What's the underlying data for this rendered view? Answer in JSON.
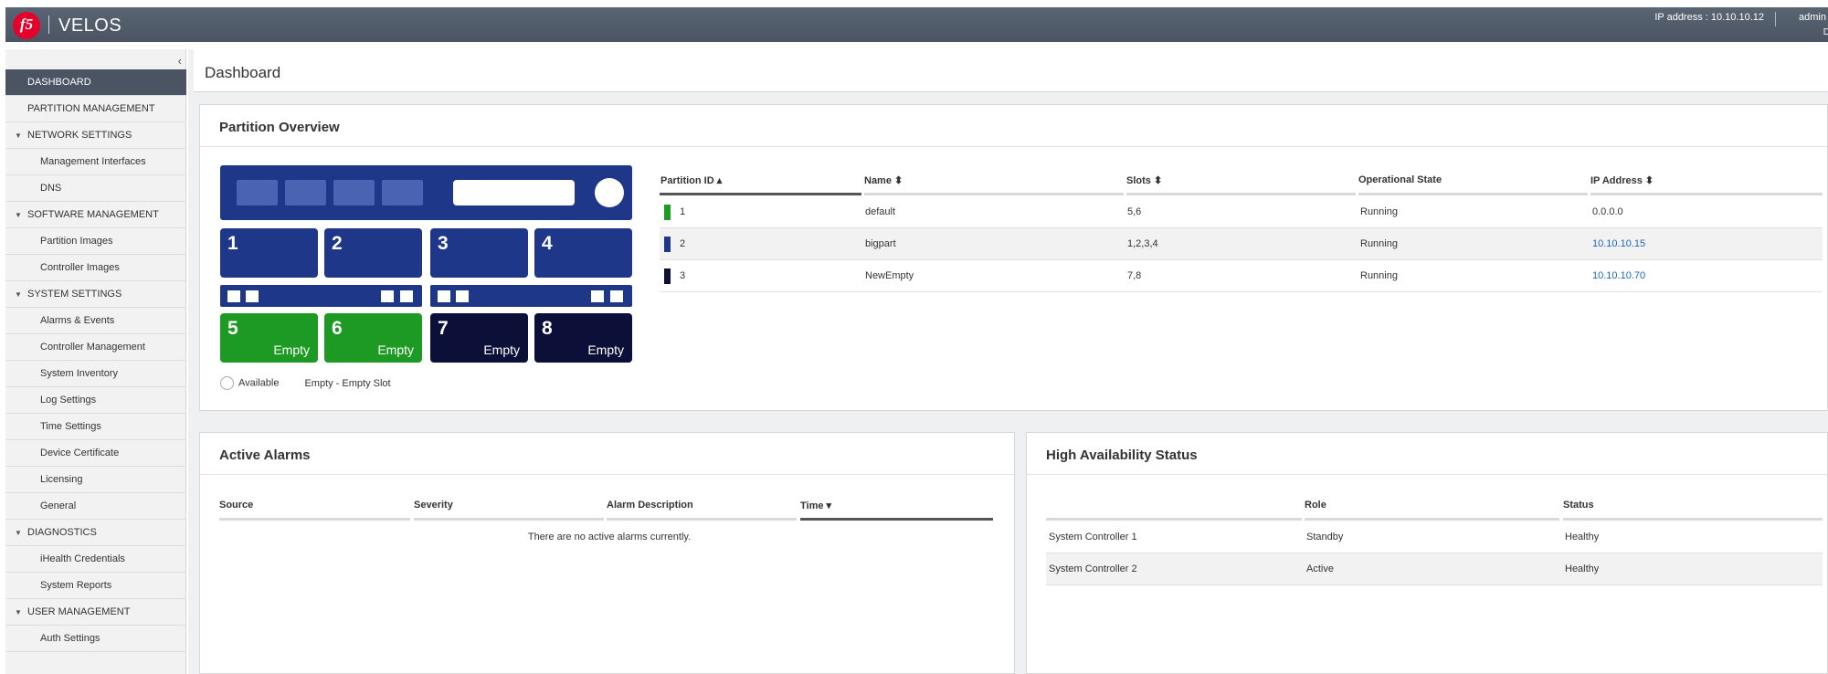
{
  "header": {
    "logo_text": "f5",
    "app_name": "VELOS",
    "ip_text": "IP address : 10.10.10.12",
    "user": "admin",
    "user_sub": "D"
  },
  "sidebar": {
    "collapse_glyph": "‹",
    "items": [
      {
        "label": "DASHBOARD",
        "kind": "top",
        "active": true
      },
      {
        "label": "PARTITION MANAGEMENT",
        "kind": "top"
      },
      {
        "label": "NETWORK SETTINGS",
        "kind": "section"
      },
      {
        "label": "Management Interfaces",
        "kind": "sub"
      },
      {
        "label": "DNS",
        "kind": "sub"
      },
      {
        "label": "SOFTWARE MANAGEMENT",
        "kind": "section"
      },
      {
        "label": "Partition Images",
        "kind": "sub"
      },
      {
        "label": "Controller Images",
        "kind": "sub"
      },
      {
        "label": "SYSTEM SETTINGS",
        "kind": "section"
      },
      {
        "label": "Alarms & Events",
        "kind": "sub"
      },
      {
        "label": "Controller Management",
        "kind": "sub"
      },
      {
        "label": "System Inventory",
        "kind": "sub"
      },
      {
        "label": "Log Settings",
        "kind": "sub"
      },
      {
        "label": "Time Settings",
        "kind": "sub"
      },
      {
        "label": "Device Certificate",
        "kind": "sub"
      },
      {
        "label": "Licensing",
        "kind": "sub"
      },
      {
        "label": "General",
        "kind": "sub"
      },
      {
        "label": "DIAGNOSTICS",
        "kind": "section"
      },
      {
        "label": "iHealth Credentials",
        "kind": "sub"
      },
      {
        "label": "System Reports",
        "kind": "sub"
      },
      {
        "label": "USER MANAGEMENT",
        "kind": "section"
      },
      {
        "label": "Auth Settings",
        "kind": "sub"
      }
    ]
  },
  "page_title": "Dashboard",
  "partition_overview": {
    "title": "Partition Overview",
    "slots": [
      {
        "num": "1",
        "state": "",
        "color": "#1f3788"
      },
      {
        "num": "2",
        "state": "",
        "color": "#1f3788"
      },
      {
        "num": "3",
        "state": "",
        "color": "#1f3788"
      },
      {
        "num": "4",
        "state": "",
        "color": "#1f3788"
      },
      {
        "num": "5",
        "state": "Empty",
        "color": "#1d9a23"
      },
      {
        "num": "6",
        "state": "Empty",
        "color": "#1d9a23"
      },
      {
        "num": "7",
        "state": "Empty",
        "color": "#0c1039"
      },
      {
        "num": "8",
        "state": "Empty",
        "color": "#0c1039"
      }
    ],
    "legend_available": "Available",
    "legend_empty": "Empty - Empty Slot",
    "columns": {
      "id": "Partition ID ▴",
      "name": "Name ⬍",
      "slots": "Slots ⬍",
      "state": "Operational State",
      "ip": "IP Address ⬍"
    },
    "rows": [
      {
        "id": "1",
        "name": "default",
        "slots": "5,6",
        "state": "Running",
        "ip": "0.0.0.0",
        "color": "#1d9a23"
      },
      {
        "id": "2",
        "name": "bigpart",
        "slots": "1,2,3,4",
        "state": "Running",
        "ip": "10.10.10.15",
        "color": "#1f3788"
      },
      {
        "id": "3",
        "name": "NewEmpty",
        "slots": "7,8",
        "state": "Running",
        "ip": "10.10.10.70",
        "color": "#0c1039"
      }
    ]
  },
  "active_alarms": {
    "title": "Active Alarms",
    "columns": {
      "source": "Source",
      "severity": "Severity",
      "description": "Alarm Description",
      "time": "Time ▾"
    },
    "empty_message": "There are no active alarms currently."
  },
  "ha_status": {
    "title": "High Availability Status",
    "columns": {
      "name": "",
      "role": "Role",
      "status": "Status"
    },
    "rows": [
      {
        "name": "System Controller 1",
        "role": "Standby",
        "status": "Healthy"
      },
      {
        "name": "System Controller 2",
        "role": "Active",
        "status": "Healthy"
      }
    ]
  }
}
